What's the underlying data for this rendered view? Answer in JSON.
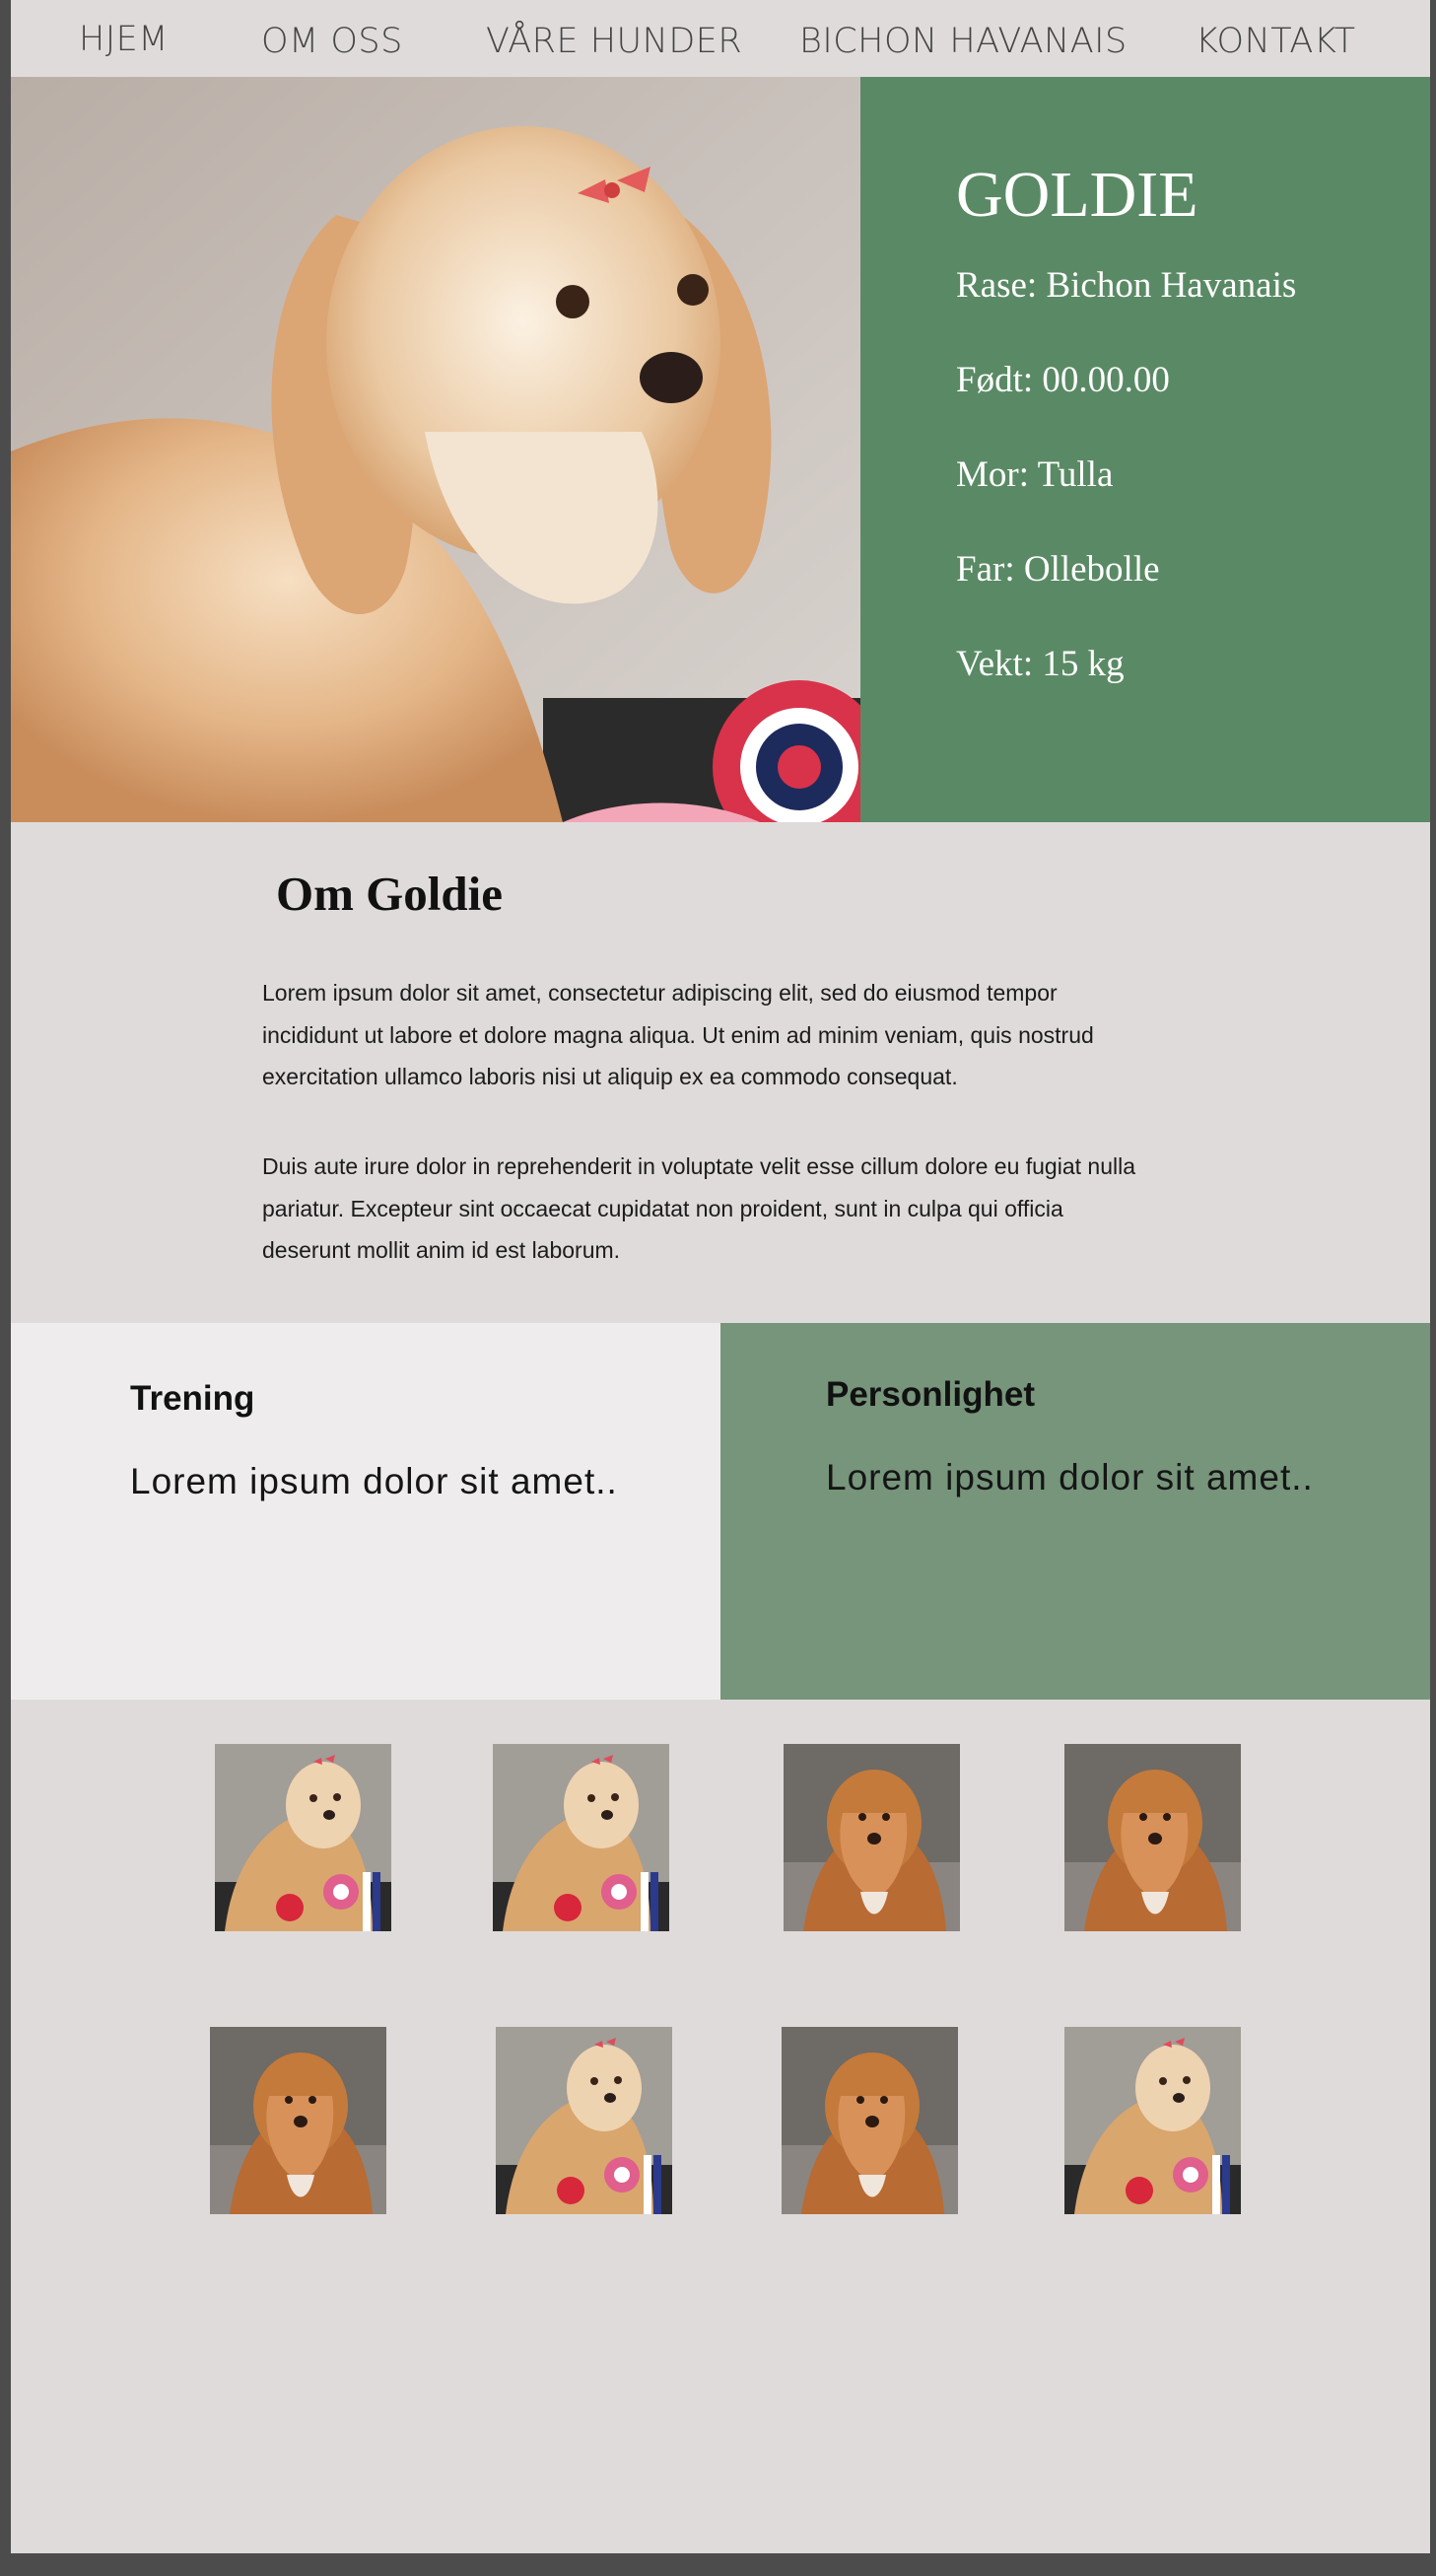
{
  "nav": {
    "items": [
      "HJEM",
      "OM OSS",
      "VÅRE HUNDER",
      "BICHON HAVANAIS",
      "KONTAKT"
    ]
  },
  "hero": {
    "name": "GOLDIE",
    "facts": [
      "Rase: Bichon Havanais",
      "Født: 00.00.00",
      "Mor: Tulla",
      "Far: Ollebolle",
      "Vekt: 15 kg"
    ]
  },
  "about": {
    "heading": "Om Goldie",
    "paragraph1": "Lorem ipsum dolor sit amet, consectetur adipiscing elit, sed do eiusmod tempor incididunt ut labore et dolore magna aliqua. Ut enim ad minim veniam, quis nostrud exercitation ullamco laboris nisi ut aliquip ex ea commodo consequat.",
    "paragraph2": "Duis aute irure dolor in reprehenderit in voluptate velit esse cillum dolore eu fugiat nulla pariatur. Excepteur sint occaecat cupidatat non proident, sunt in culpa qui officia deserunt mollit anim id est laborum."
  },
  "cards": {
    "training": {
      "title": "Trening",
      "text": "Lorem ipsum dolor sit amet.."
    },
    "personality": {
      "title": "Personlighet",
      "text": "Lorem ipsum dolor sit amet.."
    }
  },
  "gallery": {
    "photos": [
      "golden-dog-with-rosettes",
      "golden-dog-with-rosettes",
      "red-dog-on-sofa",
      "red-dog-on-sofa",
      "red-dog-on-sofa",
      "golden-dog-with-rosettes",
      "red-dog-on-sofa",
      "golden-dog-with-rosettes"
    ]
  },
  "colors": {
    "page_background": "#e0dbdb",
    "hero_panel": "#5a8a65",
    "personality_card": "#76957b",
    "training_card": "#eeecec"
  }
}
